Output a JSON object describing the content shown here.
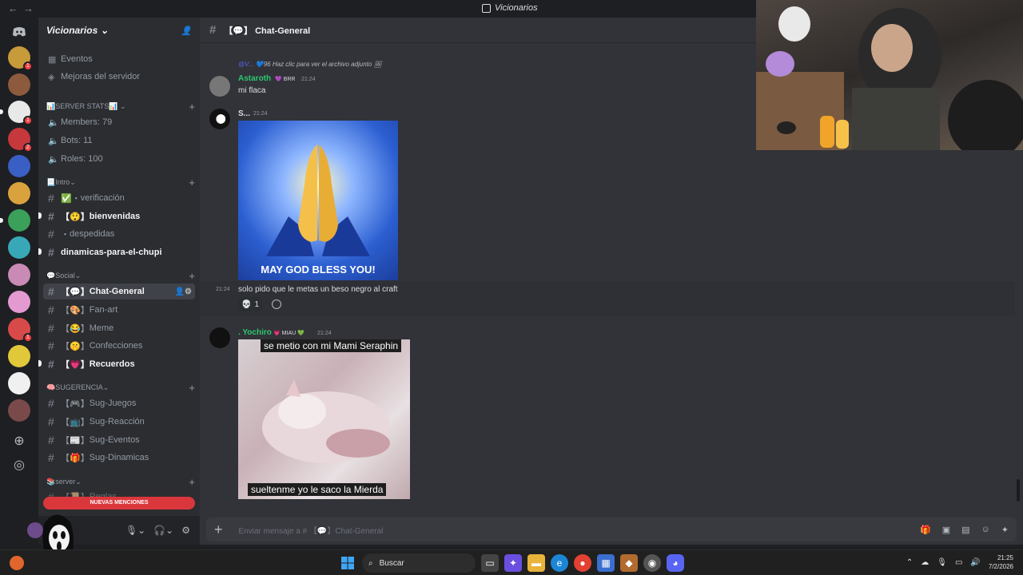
{
  "window": {
    "title": "Vicionarios"
  },
  "server": {
    "name": "Vicionarios"
  },
  "sidebar_top": [
    "Eventos",
    "Mejoras del servidor"
  ],
  "categories": {
    "server_stats": "SERVER STATS",
    "intro": "Intro",
    "social": "Social",
    "sugerencia": "SUGERENCIA",
    "server": "server"
  },
  "stats": [
    "Members: 79",
    "Bots: 11",
    "Roles: 100"
  ],
  "intro_channels": [
    "verificación",
    "bienvenidas",
    "despedidas",
    "dinamicas-para-el-chupi"
  ],
  "social_channels": [
    "Chat-General",
    "Fan-art",
    "Meme",
    "Confecciones",
    "Recuerdos"
  ],
  "sug_channels": [
    "Sug-Juegos",
    "Sug-Reacción",
    "Sug-Eventos",
    "Sug-Dinamicas"
  ],
  "server_channels": [
    "Reglas"
  ],
  "mentions_label": "NUEVAS MENCIONES",
  "channel": {
    "name": "Chat-General"
  },
  "messages": {
    "reply_preview": "Haz clic para ver el archivo adjunto",
    "reply_user": "@V...",
    "m1_author": "Astaroth",
    "m1_tag": "BRR",
    "m1_time": "21:24",
    "m1_text": "mi flaca",
    "m2_author": "S...",
    "m2_time": "21:24",
    "m2_image_caption": "MAY GOD BLESS YOU!",
    "m3_time": "21:24",
    "m3_text": "solo pido que le metas un beso negro al craft",
    "m3_reaction_count": "1",
    "m4_author": ". Yochiro",
    "m4_tag": "MIAU",
    "m4_time": "21:24",
    "m4_caption_top": "se metio con mi Mami Seraphin",
    "m4_caption_bottom": "sueltenme yo le saco la Mierda"
  },
  "composer": {
    "placeholder": "Enviar mensaje a # 【💬】Chat-General"
  },
  "taskbar": {
    "search": "Buscar",
    "time": "21:25",
    "date": "7/2/2026"
  },
  "colors": {
    "accent": "#5865f2",
    "author_green": "#2dc770",
    "mention_red": "#da373c"
  }
}
